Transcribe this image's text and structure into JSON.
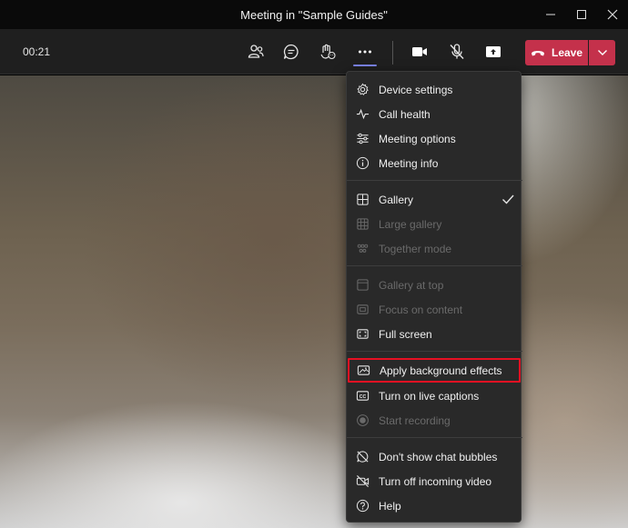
{
  "window": {
    "title": "Meeting in \"Sample Guides\""
  },
  "toolbar": {
    "timer": "00:21",
    "leave_label": "Leave"
  },
  "menu": {
    "items": [
      {
        "label": "Device settings",
        "icon": "gear-icon",
        "enabled": true
      },
      {
        "label": "Call health",
        "icon": "pulse-icon",
        "enabled": true
      },
      {
        "label": "Meeting options",
        "icon": "sliders-icon",
        "enabled": true
      },
      {
        "label": "Meeting info",
        "icon": "info-icon",
        "enabled": true
      },
      {
        "label": "Gallery",
        "icon": "grid-icon",
        "enabled": true,
        "checked": true
      },
      {
        "label": "Large gallery",
        "icon": "large-grid-icon",
        "enabled": false
      },
      {
        "label": "Together mode",
        "icon": "together-mode-icon",
        "enabled": false
      },
      {
        "label": "Gallery at top",
        "icon": "gallery-top-icon",
        "enabled": false
      },
      {
        "label": "Focus on content",
        "icon": "focus-icon",
        "enabled": false
      },
      {
        "label": "Full screen",
        "icon": "fullscreen-icon",
        "enabled": true
      },
      {
        "label": "Apply background effects",
        "icon": "background-effects-icon",
        "enabled": true,
        "highlighted": true
      },
      {
        "label": "Turn on live captions",
        "icon": "captions-icon",
        "enabled": true
      },
      {
        "label": "Start recording",
        "icon": "record-icon",
        "enabled": false
      },
      {
        "label": "Don't show chat bubbles",
        "icon": "chat-bubble-off-icon",
        "enabled": true
      },
      {
        "label": "Turn off incoming video",
        "icon": "video-off-icon",
        "enabled": true
      },
      {
        "label": "Help",
        "icon": "help-icon",
        "enabled": true
      }
    ]
  },
  "colors": {
    "leave_red": "#c4314b",
    "accent": "#7b83eb",
    "highlight_border": "#e81123"
  }
}
